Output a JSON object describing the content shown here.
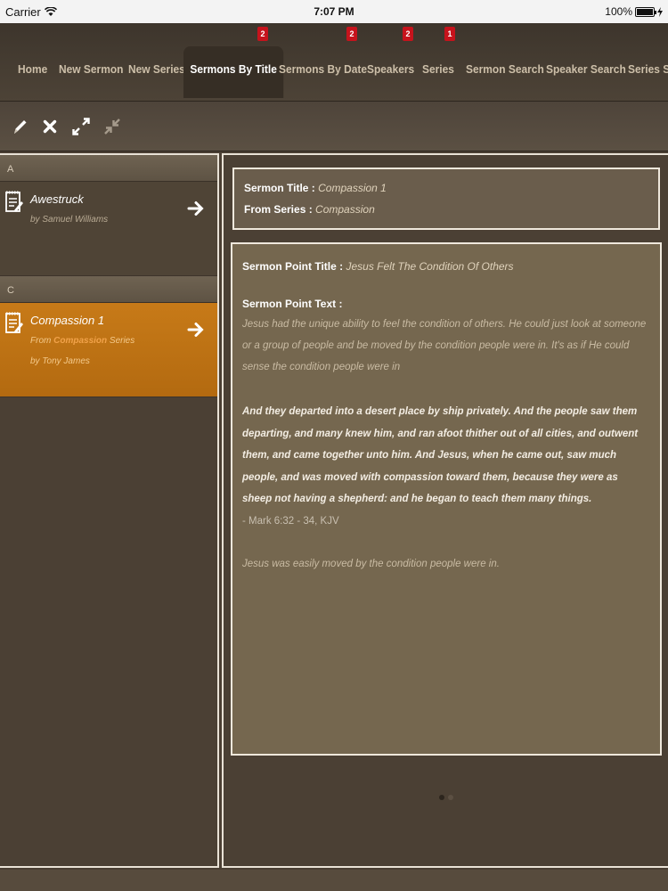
{
  "status_bar": {
    "carrier": "Carrier",
    "time": "7:07 PM",
    "battery": "100%"
  },
  "tabs": [
    {
      "label": "Home"
    },
    {
      "label": "New Sermon"
    },
    {
      "label": "New Series"
    },
    {
      "label": "Sermons By Title",
      "badge": "2",
      "active": true
    },
    {
      "label": "Sermons By Date",
      "badge": "2"
    },
    {
      "label": "Speakers",
      "badge": "2"
    },
    {
      "label": "Series",
      "badge": "1"
    },
    {
      "label": "Sermon Search"
    },
    {
      "label": "Speaker Search"
    },
    {
      "label": "Series S"
    }
  ],
  "toolbar": {
    "icons": [
      "pencil-icon",
      "close-icon",
      "expand-icon",
      "collapse-icon"
    ]
  },
  "list": {
    "sections": [
      {
        "header": "A",
        "items": [
          {
            "title": "Awestruck",
            "subtitle": "by Samuel Williams"
          }
        ]
      },
      {
        "header": "C",
        "items": [
          {
            "title": "Compassion 1",
            "from_prefix": "From ",
            "from_series": "Compassion",
            "from_suffix": " Series",
            "by": "by Tony James",
            "selected": true
          }
        ]
      }
    ]
  },
  "detail": {
    "sermon_title_label": "Sermon Title :",
    "sermon_title": "Compassion 1",
    "from_series_label": "From Series :",
    "from_series": "Compassion",
    "point_title_label": "Sermon Point Title :",
    "point_title": "Jesus Felt The Condition Of Others",
    "point_text_label": "Sermon Point Text :",
    "point_text": "Jesus had the unique ability to feel the condition of others. He could just look at someone or a group of people and be moved by the condition people were in. It's as if He could sense the condition people were in",
    "scripture": "And they departed into a desert place by ship privately. And the people saw them departing, and many knew him, and ran afoot thither out of all cities, and outwent them, and came together unto him. And Jesus, when he came out, saw much people, and was moved with compassion toward them, because they were as sheep not having a shepherd: and he began to teach them many things.",
    "scripture_ref": "- Mark 6:32 - 34, KJV",
    "closing": "Jesus was easily moved by the condition people were in."
  },
  "colors": {
    "accent": "#c77a18",
    "badge": "#c6131c",
    "background": "#4b4034"
  }
}
